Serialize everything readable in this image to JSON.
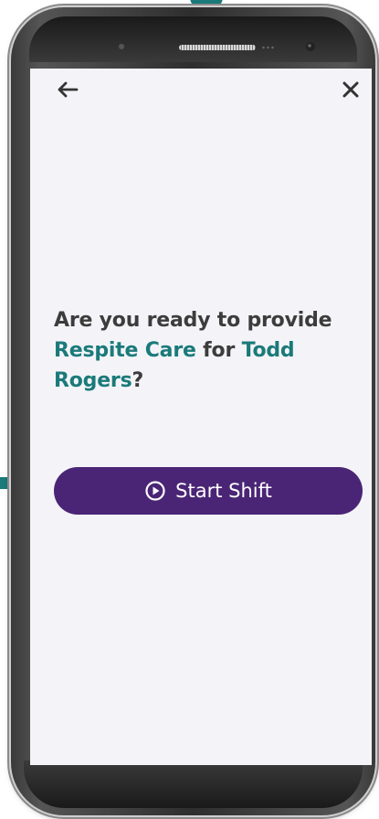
{
  "header": {
    "back_icon": "arrow-left-icon",
    "close_icon": "close-icon"
  },
  "prompt": {
    "part1": "Are you ready to provide ",
    "service": "Respite Care",
    "part2": " for ",
    "client": "Todd Rogers",
    "part3": "?"
  },
  "start_button": {
    "icon": "play-circle-icon",
    "label": "Start Shift"
  },
  "colors": {
    "accent_teal": "#1b7a7a",
    "button_purple": "#4a2576",
    "text_dark": "#3c3c3c",
    "screen_bg": "#f4f4f8"
  }
}
